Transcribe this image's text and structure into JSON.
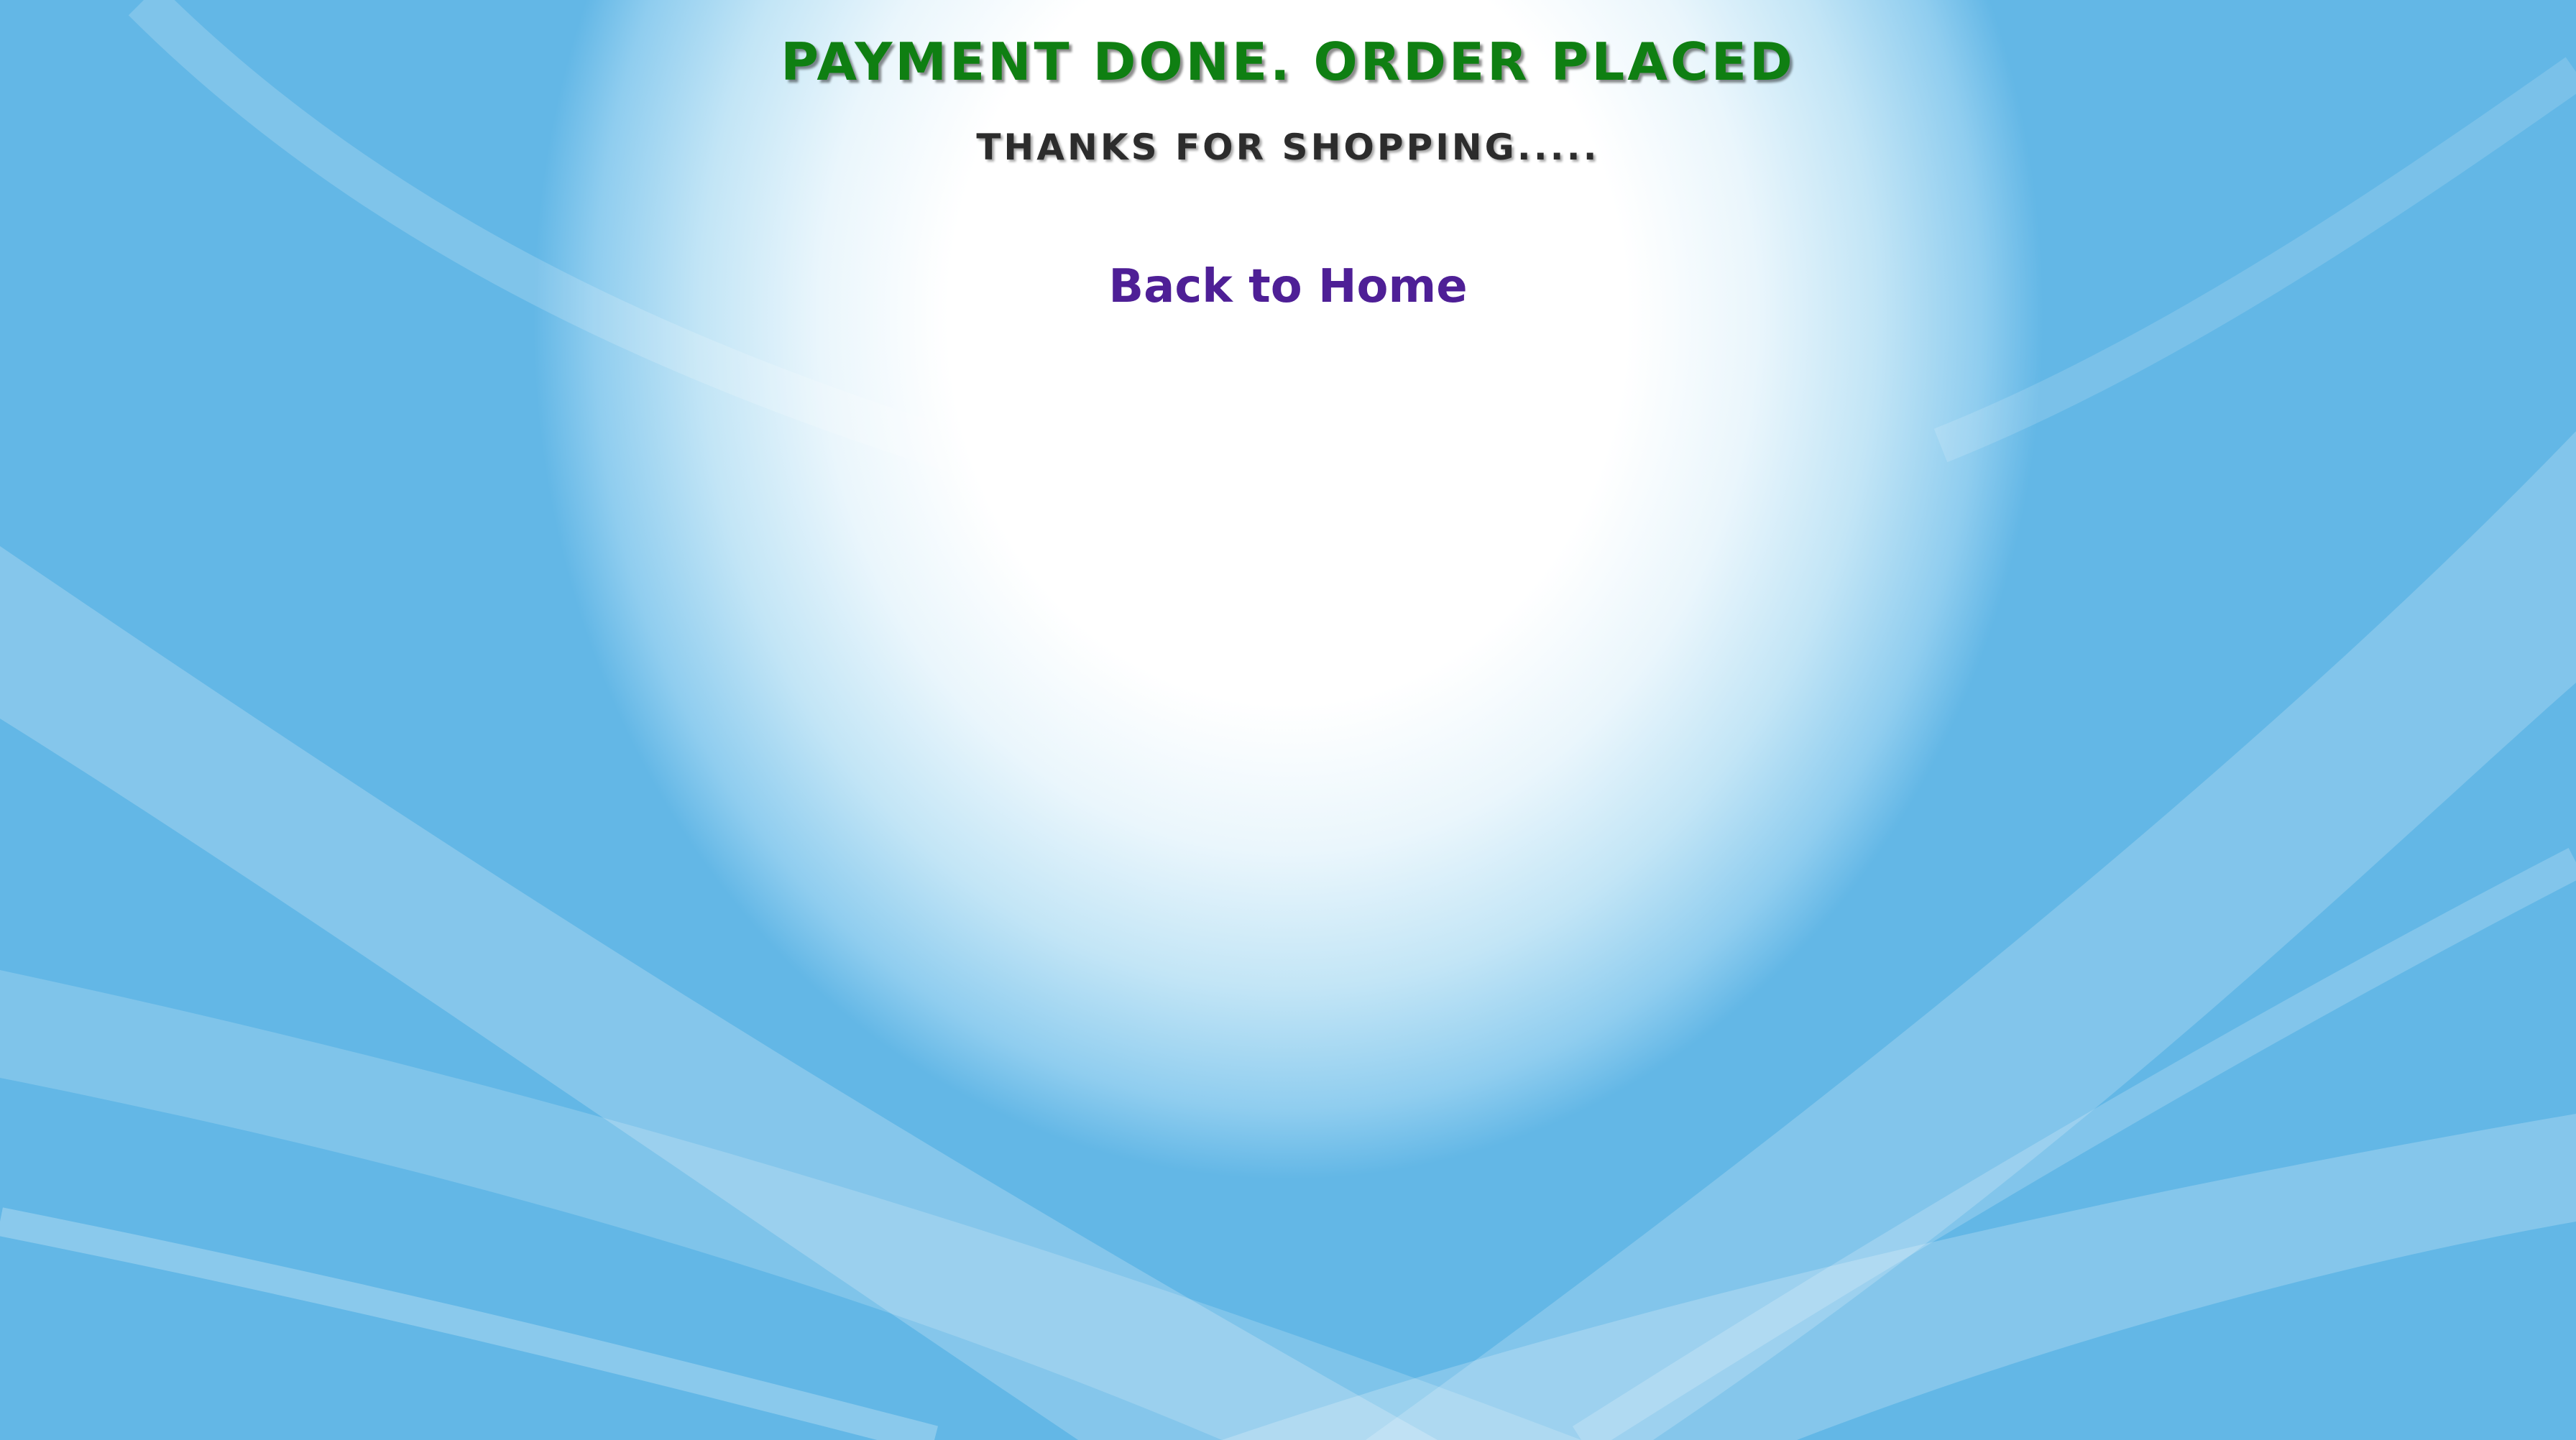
{
  "page": {
    "headline": "PAYMENT DONE. ORDER PLACED",
    "subheadline": "THANKS FOR SHOPPING.....",
    "back_link_label": "Back to Home"
  },
  "colors": {
    "headline": "#0f7f12",
    "subheadline": "#2c2c2c",
    "link": "#4e1f96",
    "background_light": "#ffffff",
    "background_blue": "#63b7e6"
  }
}
